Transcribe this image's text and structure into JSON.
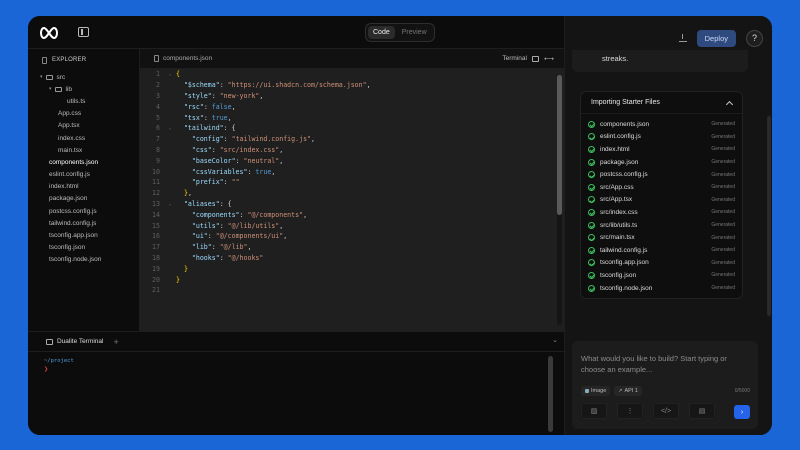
{
  "header": {
    "tabs": [
      {
        "label": "Code",
        "active": true
      },
      {
        "label": "Preview",
        "active": false
      }
    ]
  },
  "explorer": {
    "title": "EXPLORER",
    "items": [
      {
        "label": "src",
        "depth": 0,
        "type": "folder"
      },
      {
        "label": "lib",
        "depth": 1,
        "type": "folder"
      },
      {
        "label": "utils.ts",
        "depth": 2,
        "type": "file"
      },
      {
        "label": "App.css",
        "depth": 1,
        "type": "file"
      },
      {
        "label": "App.tsx",
        "depth": 1,
        "type": "file"
      },
      {
        "label": "index.css",
        "depth": 1,
        "type": "file"
      },
      {
        "label": "main.tsx",
        "depth": 1,
        "type": "file"
      },
      {
        "label": "components.json",
        "depth": 0,
        "type": "file",
        "active": true
      },
      {
        "label": "eslint.config.js",
        "depth": 0,
        "type": "file"
      },
      {
        "label": "index.html",
        "depth": 0,
        "type": "file"
      },
      {
        "label": "package.json",
        "depth": 0,
        "type": "file"
      },
      {
        "label": "postcss.config.js",
        "depth": 0,
        "type": "file"
      },
      {
        "label": "tailwind.config.js",
        "depth": 0,
        "type": "file"
      },
      {
        "label": "tsconfig.app.json",
        "depth": 0,
        "type": "file"
      },
      {
        "label": "tsconfig.json",
        "depth": 0,
        "type": "file"
      },
      {
        "label": "tsconfig.node.json",
        "depth": 0,
        "type": "file"
      }
    ]
  },
  "editor": {
    "file_tab": "components.json",
    "terminal_toggle": "Terminal",
    "lines": [
      "{",
      "  \"$schema\": \"https://ui.shadcn.com/schema.json\",",
      "  \"style\": \"new-york\",",
      "  \"rsc\": false,",
      "  \"tsx\": true,",
      "  \"tailwind\": {",
      "    \"config\": \"tailwind.config.js\",",
      "    \"css\": \"src/index.css\",",
      "    \"baseColor\": \"neutral\",",
      "    \"cssVariables\": true,",
      "    \"prefix\": \"\"",
      "  },",
      "  \"aliases\": {",
      "    \"components\": \"@/components\",",
      "    \"utils\": \"@/lib/utils\",",
      "    \"ui\": \"@/components/ui\",",
      "    \"lib\": \"@/lib\",",
      "    \"hooks\": \"@/hooks\"",
      "  }",
      "}",
      ""
    ],
    "fold_lines": [
      1,
      6,
      13
    ]
  },
  "terminal": {
    "tab_label": "Dualite Terminal",
    "path": "~/project",
    "prompt": "❯"
  },
  "right_panel": {
    "deploy_label": "Deploy",
    "help_label": "?",
    "streaks_text": "streaks.",
    "import_title": "Importing Starter Files",
    "files": [
      {
        "name": "components.json",
        "status": "Generated"
      },
      {
        "name": "eslint.config.js",
        "status": "Generated"
      },
      {
        "name": "index.html",
        "status": "Generated"
      },
      {
        "name": "package.json",
        "status": "Generated"
      },
      {
        "name": "postcss.config.js",
        "status": "Generated"
      },
      {
        "name": "src/App.css",
        "status": "Generated"
      },
      {
        "name": "src/App.tsx",
        "status": "Generated"
      },
      {
        "name": "src/index.css",
        "status": "Generated"
      },
      {
        "name": "src/lib/utils.ts",
        "status": "Generated"
      },
      {
        "name": "src/main.tsx",
        "status": "Generated"
      },
      {
        "name": "tailwind.config.js",
        "status": "Generated"
      },
      {
        "name": "tsconfig.app.json",
        "status": "Generated"
      },
      {
        "name": "tsconfig.json",
        "status": "Generated"
      },
      {
        "name": "tsconfig.node.json",
        "status": "Generated"
      }
    ],
    "prompt_placeholder": "What would you like to build? Start typing or choose an example...",
    "chips": [
      {
        "label": "Image"
      },
      {
        "label": "API 1"
      }
    ],
    "counter": "0/5000"
  },
  "colors": {
    "accent": "#2563eb",
    "background": "#1a66d6",
    "success": "#3bbf5e"
  }
}
